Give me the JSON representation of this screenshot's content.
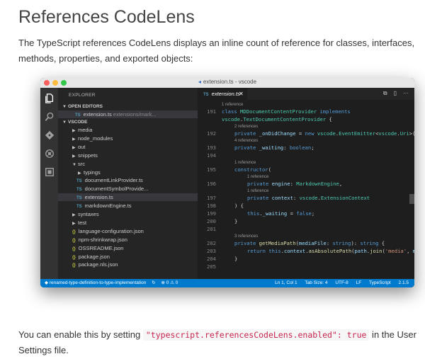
{
  "doc": {
    "title": "References CodeLens",
    "intro": "The TypeScript references CodeLens displays an inline count of reference for classes, interfaces, methods, properties, and exported objects:",
    "outro_before": "You can enable this by setting ",
    "outro_code": "\"typescript.referencesCodeLens.enabled\": true",
    "outro_after": " in the User Settings file."
  },
  "window": {
    "title": "extension.ts - vscode"
  },
  "activity_icons": [
    "files-icon",
    "search-icon",
    "git-icon",
    "debug-icon",
    "extensions-icon"
  ],
  "explorer": {
    "header": "EXPLORER",
    "open_editors_label": "OPEN EDITORS",
    "open_editor": {
      "name": "extension.ts",
      "path": "extensions/mark..."
    },
    "project_label": "VSCODE",
    "items": [
      {
        "label": "media",
        "type": "folder"
      },
      {
        "label": "node_modules",
        "type": "folder"
      },
      {
        "label": "out",
        "type": "folder"
      },
      {
        "label": "snippets",
        "type": "folder"
      },
      {
        "label": "src",
        "type": "folder-open"
      },
      {
        "label": "typings",
        "type": "subfolder"
      },
      {
        "label": "documentLinkProvider.ts",
        "type": "ts"
      },
      {
        "label": "documentSymbolProvide...",
        "type": "ts"
      },
      {
        "label": "extension.ts",
        "type": "ts"
      },
      {
        "label": "markdownEngine.ts",
        "type": "ts"
      },
      {
        "label": "syntaxes",
        "type": "folder"
      },
      {
        "label": "test",
        "type": "folder"
      },
      {
        "label": "language-configuration.json",
        "type": "json"
      },
      {
        "label": "npm-shrinkwrap.json",
        "type": "json"
      },
      {
        "label": "OSSREADME.json",
        "type": "json"
      },
      {
        "label": "package.json",
        "type": "json"
      },
      {
        "label": "package.nls.json",
        "type": "json"
      }
    ]
  },
  "editor": {
    "tab_label": "extension.ts",
    "tab_badge": "TS",
    "code_lines": [
      {
        "num": "191",
        "lens": "1 reference",
        "indent": 0,
        "tokens": [
          [
            "kw",
            "class "
          ],
          [
            "ty",
            "MDDocumentContentProvider "
          ],
          [
            "kw",
            "implements"
          ]
        ]
      },
      {
        "num": "",
        "lens": "",
        "indent": 0,
        "tokens": [
          [
            "ty",
            "vscode"
          ],
          [
            "",
            "."
          ],
          [
            "ty",
            "TextDocumentContentProvider"
          ],
          [
            "",
            " {"
          ]
        ]
      },
      {
        "num": "192",
        "lens": "2 references",
        "indent": 1,
        "tokens": [
          [
            "kw",
            "private "
          ],
          [
            "va",
            "_onDidChange"
          ],
          [
            "",
            " = "
          ],
          [
            "kw",
            "new "
          ],
          [
            "ty",
            "vscode"
          ],
          [
            "",
            "."
          ],
          [
            "ty",
            "EventEmitter"
          ],
          [
            "",
            "<"
          ],
          [
            "ty",
            "vscode"
          ],
          [
            "",
            "."
          ],
          [
            "ty",
            "Uri"
          ],
          [
            "",
            ">();"
          ]
        ]
      },
      {
        "num": "193",
        "lens": "4 references",
        "indent": 1,
        "tokens": [
          [
            "kw",
            "private "
          ],
          [
            "va",
            "_waiting"
          ],
          [
            "",
            ": "
          ],
          [
            "kw",
            "boolean"
          ],
          [
            "",
            ";"
          ]
        ]
      },
      {
        "num": "194",
        "lens": "",
        "indent": 0,
        "tokens": []
      },
      {
        "num": "195",
        "lens": "1 reference",
        "indent": 1,
        "tokens": [
          [
            "kw",
            "constructor"
          ],
          [
            "",
            "("
          ]
        ]
      },
      {
        "num": "196",
        "lens": "1 reference",
        "indent": 2,
        "tokens": [
          [
            "kw",
            "private "
          ],
          [
            "va",
            "engine"
          ],
          [
            "",
            ": "
          ],
          [
            "ty",
            "MarkdownEngine"
          ],
          [
            "",
            ","
          ]
        ]
      },
      {
        "num": "197",
        "lens": "1 reference",
        "indent": 2,
        "tokens": [
          [
            "kw",
            "private "
          ],
          [
            "va",
            "context"
          ],
          [
            "",
            ": "
          ],
          [
            "ty",
            "vscode"
          ],
          [
            "",
            "."
          ],
          [
            "ty",
            "ExtensionContext"
          ]
        ]
      },
      {
        "num": "198",
        "lens": "",
        "indent": 1,
        "tokens": [
          [
            "",
            ") {"
          ]
        ]
      },
      {
        "num": "199",
        "lens": "",
        "indent": 2,
        "tokens": [
          [
            "kw",
            "this"
          ],
          [
            "",
            "."
          ],
          [
            "va",
            "_waiting"
          ],
          [
            "",
            " = "
          ],
          [
            "kw",
            "false"
          ],
          [
            "",
            ";"
          ]
        ]
      },
      {
        "num": "200",
        "lens": "",
        "indent": 1,
        "tokens": [
          [
            "",
            "}"
          ]
        ]
      },
      {
        "num": "201",
        "lens": "",
        "indent": 0,
        "tokens": []
      },
      {
        "num": "202",
        "lens": "3 references",
        "indent": 1,
        "tokens": [
          [
            "kw",
            "private "
          ],
          [
            "fn",
            "getMediaPath"
          ],
          [
            "",
            "("
          ],
          [
            "va",
            "mediaFile"
          ],
          [
            "",
            ": "
          ],
          [
            "kw",
            "string"
          ],
          [
            "",
            "): "
          ],
          [
            "kw",
            "string"
          ],
          [
            "",
            " {"
          ]
        ]
      },
      {
        "num": "203",
        "lens": "",
        "indent": 2,
        "tokens": [
          [
            "kw",
            "return "
          ],
          [
            "kw",
            "this"
          ],
          [
            "",
            "."
          ],
          [
            "va",
            "context"
          ],
          [
            "",
            "."
          ],
          [
            "fn",
            "asAbsolutePath"
          ],
          [
            "",
            "("
          ],
          [
            "va",
            "path"
          ],
          [
            "",
            "."
          ],
          [
            "fn",
            "join"
          ],
          [
            "",
            "("
          ],
          [
            "str",
            "'media'"
          ],
          [
            "",
            ", "
          ],
          [
            "va",
            "mediaFile"
          ],
          [
            "",
            "));"
          ]
        ]
      },
      {
        "num": "204",
        "lens": "",
        "indent": 1,
        "tokens": [
          [
            "",
            "}"
          ]
        ]
      },
      {
        "num": "205",
        "lens": "",
        "indent": 0,
        "tokens": []
      }
    ]
  },
  "statusbar": {
    "branch": "renamed-type-definition-to-type-implementation",
    "problems": "⊗ 0 ⚠ 0",
    "position": "Ln 1, Col 1",
    "tab_size": "Tab Size: 4",
    "encoding": "UTF-8",
    "eol": "LF",
    "language": "TypeScript",
    "version": "2.1.5"
  }
}
